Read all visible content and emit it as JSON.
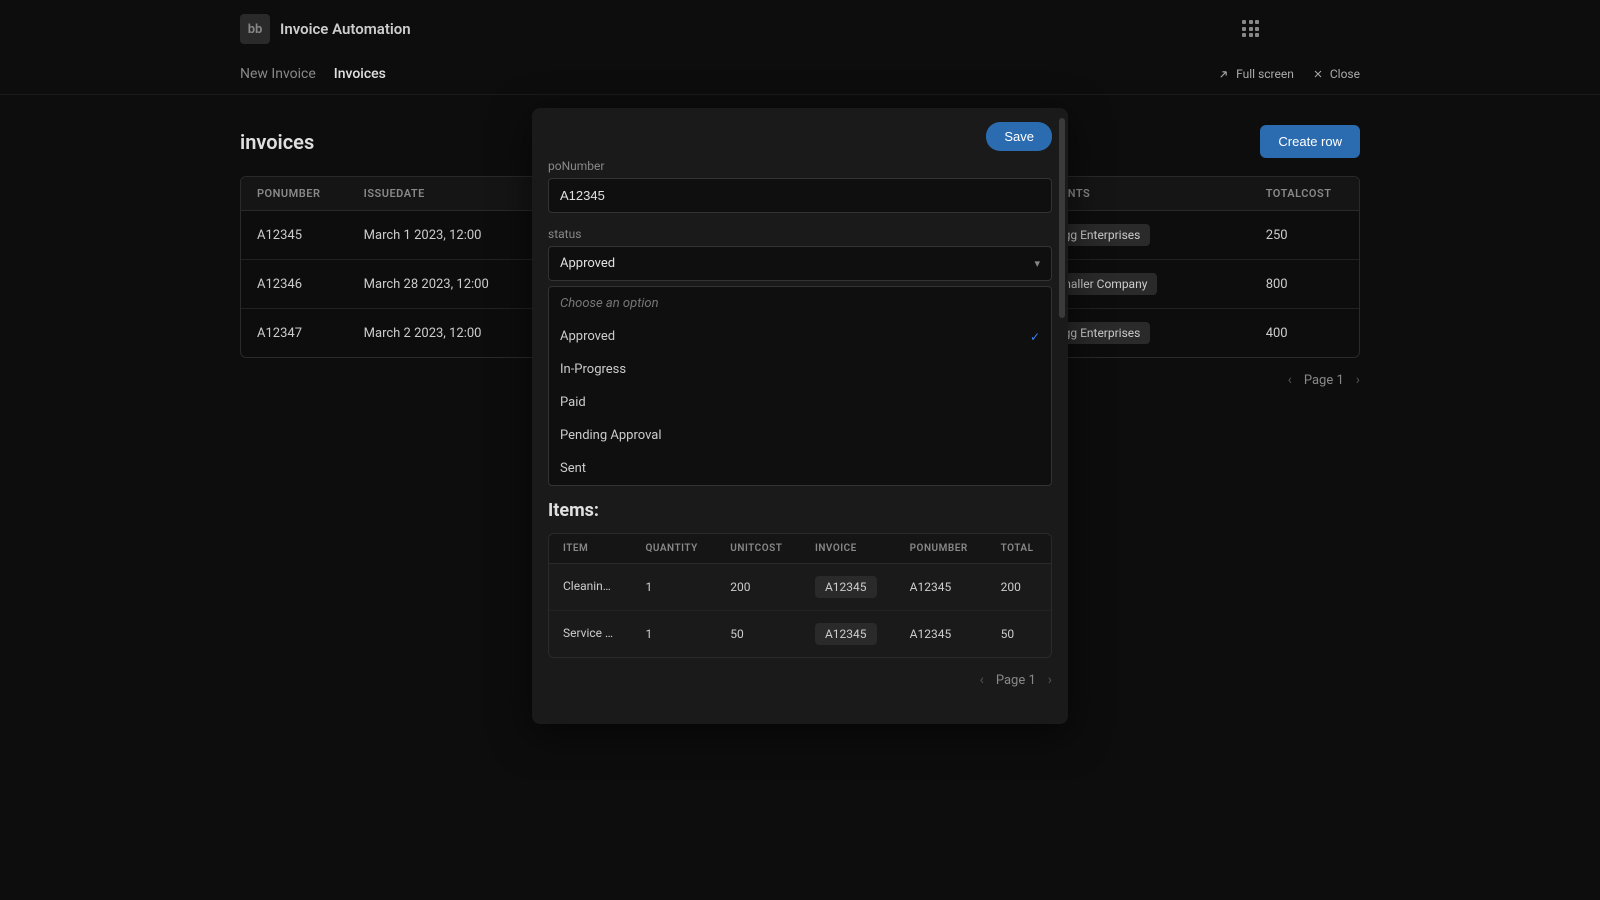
{
  "header": {
    "logo_text": "bb",
    "app_title": "Invoice Automation"
  },
  "nav": {
    "tabs": [
      "New Invoice",
      "Invoices"
    ],
    "fullscreen_label": "Full screen",
    "close_label": "Close"
  },
  "page": {
    "title": "invoices",
    "create_button": "Create row"
  },
  "table": {
    "headers": [
      "PONUMBER",
      "ISSUEDATE",
      "CLIENTS",
      "TOTALCOST"
    ],
    "rows": [
      {
        "po": "A12345",
        "date": "March 1 2023, 12:00",
        "client": "Bigg Enterprises",
        "total": "250"
      },
      {
        "po": "A12346",
        "date": "March 28 2023, 12:00",
        "client": "Smaller Company",
        "total": "800"
      },
      {
        "po": "A12347",
        "date": "March 2 2023, 12:00",
        "client": "Bigg Enterprises",
        "total": "400"
      }
    ]
  },
  "pagination": {
    "label": "Page 1"
  },
  "modal": {
    "save_label": "Save",
    "po_label": "poNumber",
    "po_value": "A12345",
    "status_label": "status",
    "status_value": "Approved",
    "dropdown": {
      "placeholder": "Choose an option",
      "options": [
        "Approved",
        "In-Progress",
        "Paid",
        "Pending Approval",
        "Sent"
      ],
      "selected": "Approved"
    },
    "items_heading": "Items:",
    "items_headers": [
      "ITEM",
      "QUANTITY",
      "UNITCOST",
      "INVOICE",
      "PONUMBER",
      "TOTAL"
    ],
    "items_rows": [
      {
        "item": "Cleanin…",
        "qty": "1",
        "unit": "200",
        "invoice": "A12345",
        "po": "A12345",
        "total": "200"
      },
      {
        "item": "Service …",
        "qty": "1",
        "unit": "50",
        "invoice": "A12345",
        "po": "A12345",
        "total": "50"
      }
    ],
    "pagination_label": "Page 1"
  }
}
